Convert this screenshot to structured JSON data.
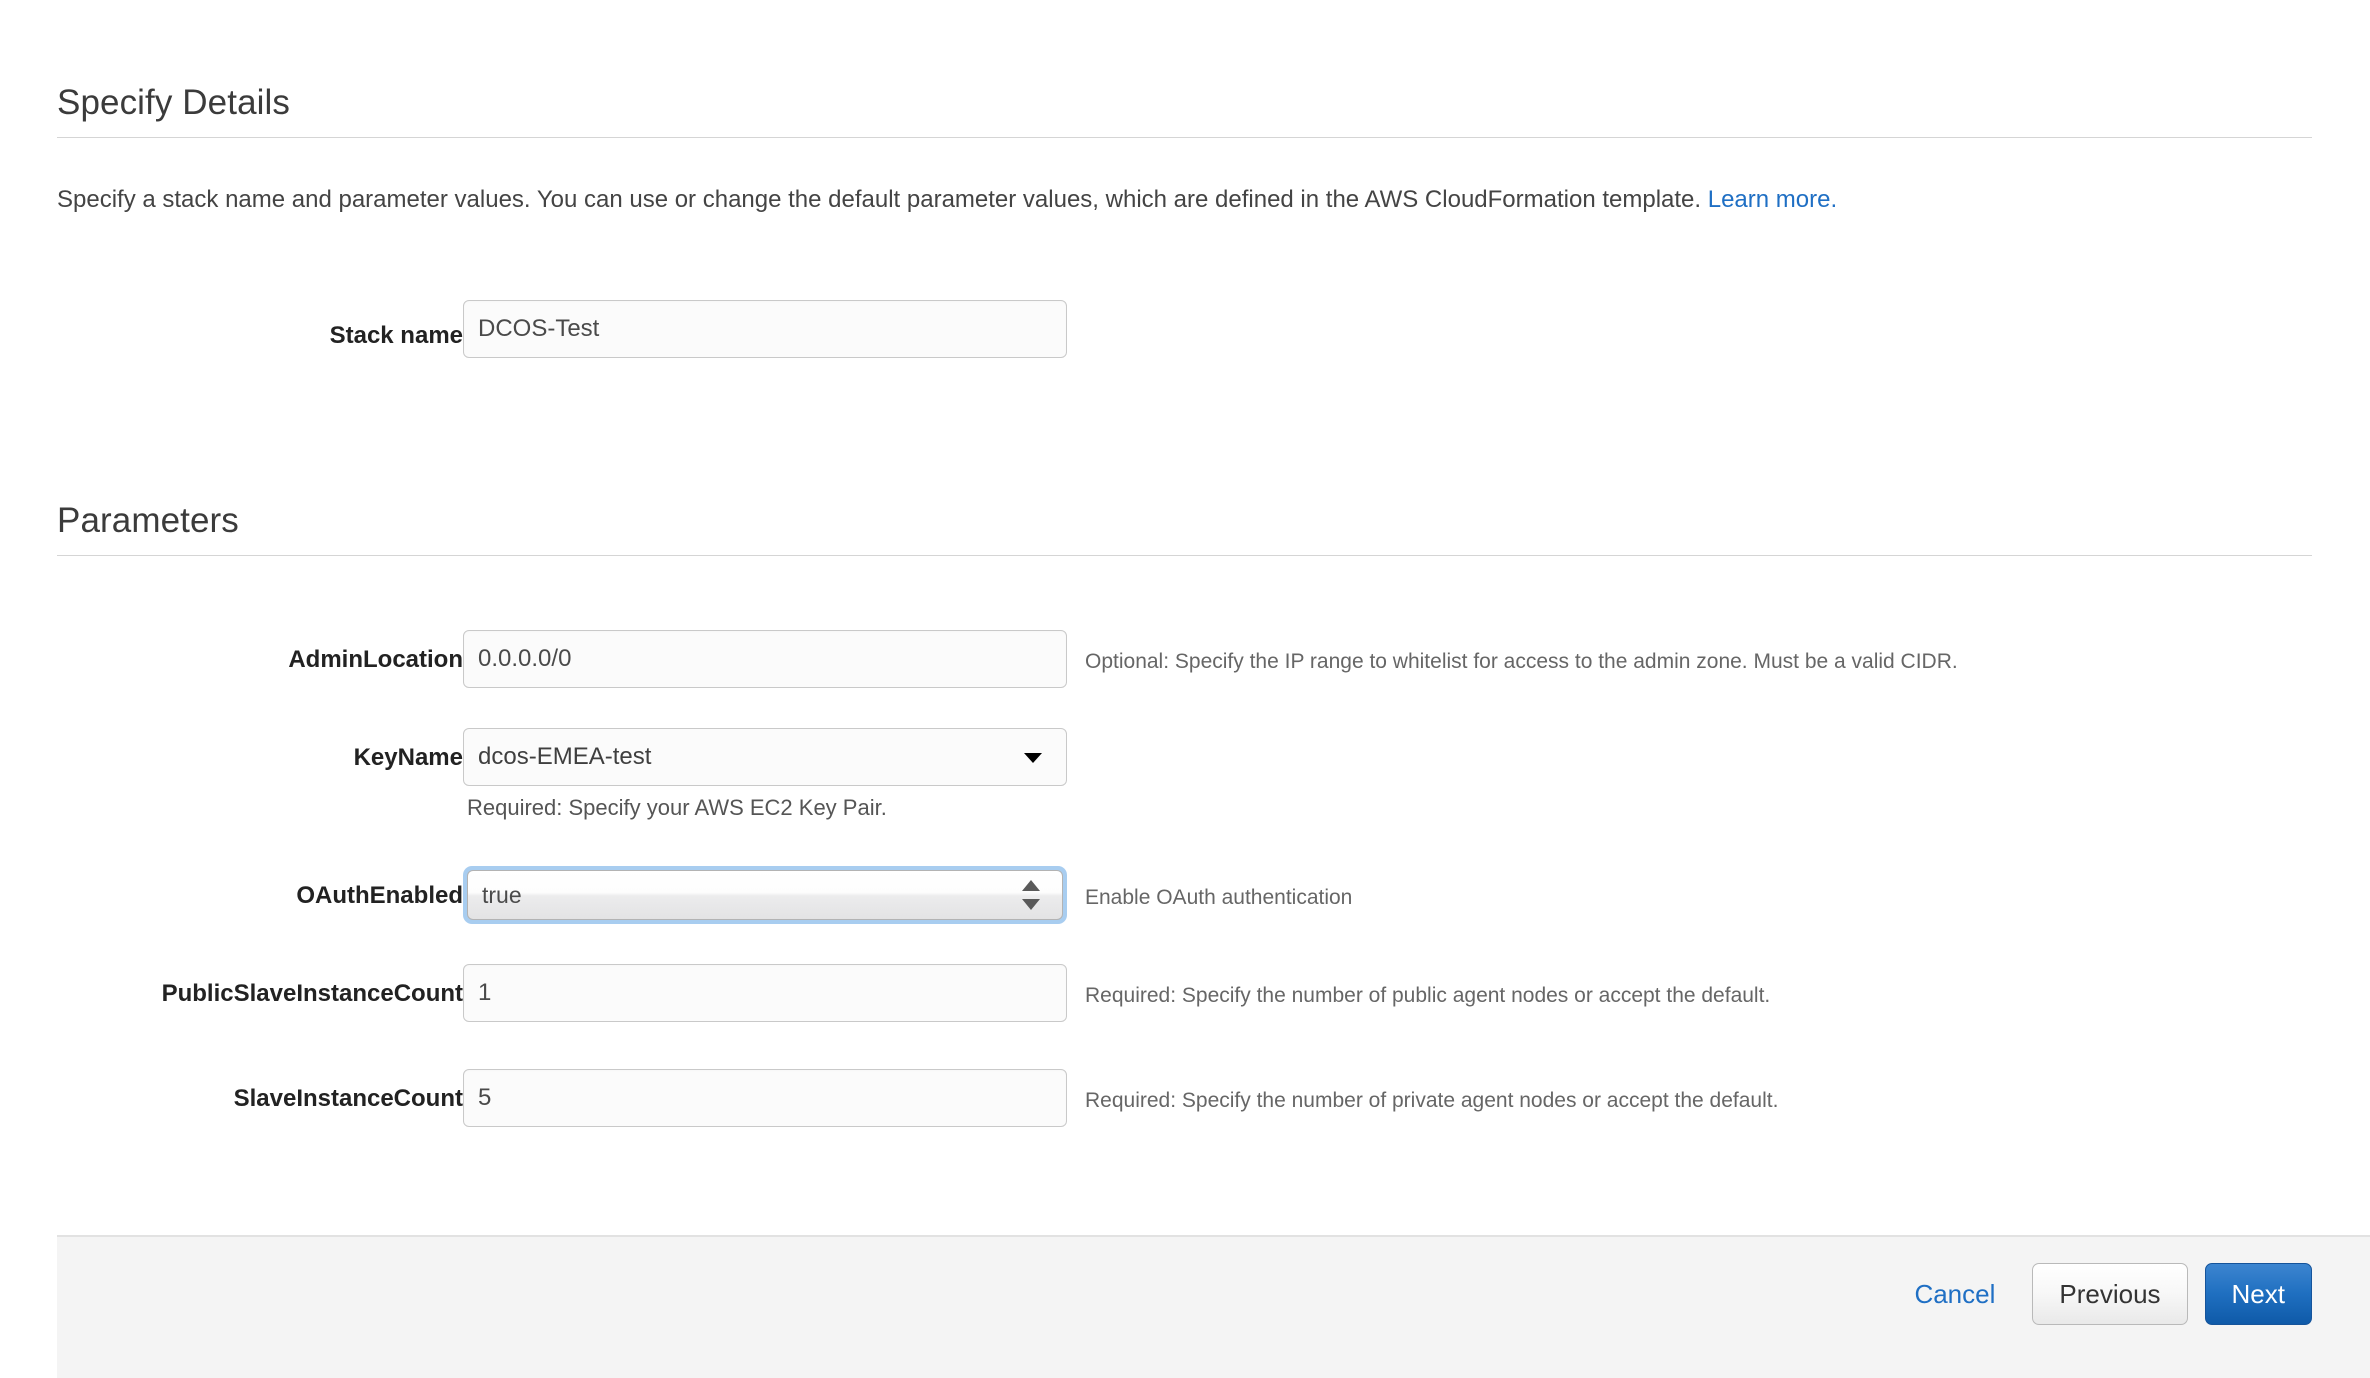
{
  "sections": {
    "specify_details": {
      "title": "Specify Details",
      "intro_before_link": "Specify a stack name and parameter values. You can use or change the default parameter values, which are defined in the AWS CloudFormation template. ",
      "intro_link": "Learn more."
    },
    "parameters": {
      "title": "Parameters"
    }
  },
  "stack_name": {
    "label": "Stack name",
    "value": "DCOS-Test",
    "placeholder": ""
  },
  "parameters": [
    {
      "label": "AdminLocation",
      "kind": "text",
      "value": "0.0.0.0/0",
      "help_right": "Optional: Specify the IP range to whitelist for access to the admin zone. Must be a valid CIDR.",
      "help_below": ""
    },
    {
      "label": "KeyName",
      "kind": "dropdown",
      "value": "dcos-EMEA-test",
      "help_right": "",
      "help_below": "Required: Specify your AWS EC2 Key Pair."
    },
    {
      "label": "OAuthEnabled",
      "kind": "select-focused",
      "value": "true",
      "help_right": "Enable OAuth authentication",
      "help_below": ""
    },
    {
      "label": "PublicSlaveInstanceCount",
      "kind": "text",
      "value": "1",
      "help_right": "Required: Specify the number of public agent nodes or accept the default.",
      "help_below": ""
    },
    {
      "label": "SlaveInstanceCount",
      "kind": "text",
      "value": "5",
      "help_right": "Required: Specify the number of private agent nodes or accept the default.",
      "help_below": ""
    }
  ],
  "footer": {
    "cancel_label": "Cancel",
    "previous_label": "Previous",
    "next_label": "Next"
  },
  "colors": {
    "link": "#1f6fc4",
    "primary_button": "#1f6fc0",
    "focus_ring": "#a8cdf0",
    "footer_background": "#f4f4f4"
  }
}
